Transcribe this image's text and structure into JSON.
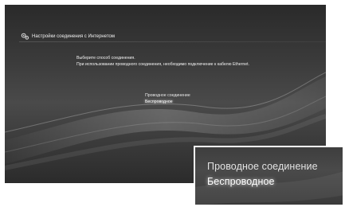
{
  "header": {
    "title": "Настройки соединения с Интернетом",
    "icon": "settings-gear-icon"
  },
  "prompt": {
    "line1": "Выберите способ соединения.",
    "line2": "При использовании проводного соединения, необходимо подключение к кабелю Ethernet."
  },
  "menu": {
    "options": [
      "Проводное соединение",
      "Беспроводное"
    ],
    "selected": "Беспроводное"
  },
  "zoom": {
    "line1": "Проводное соединение",
    "line2": "Беспроводное"
  }
}
